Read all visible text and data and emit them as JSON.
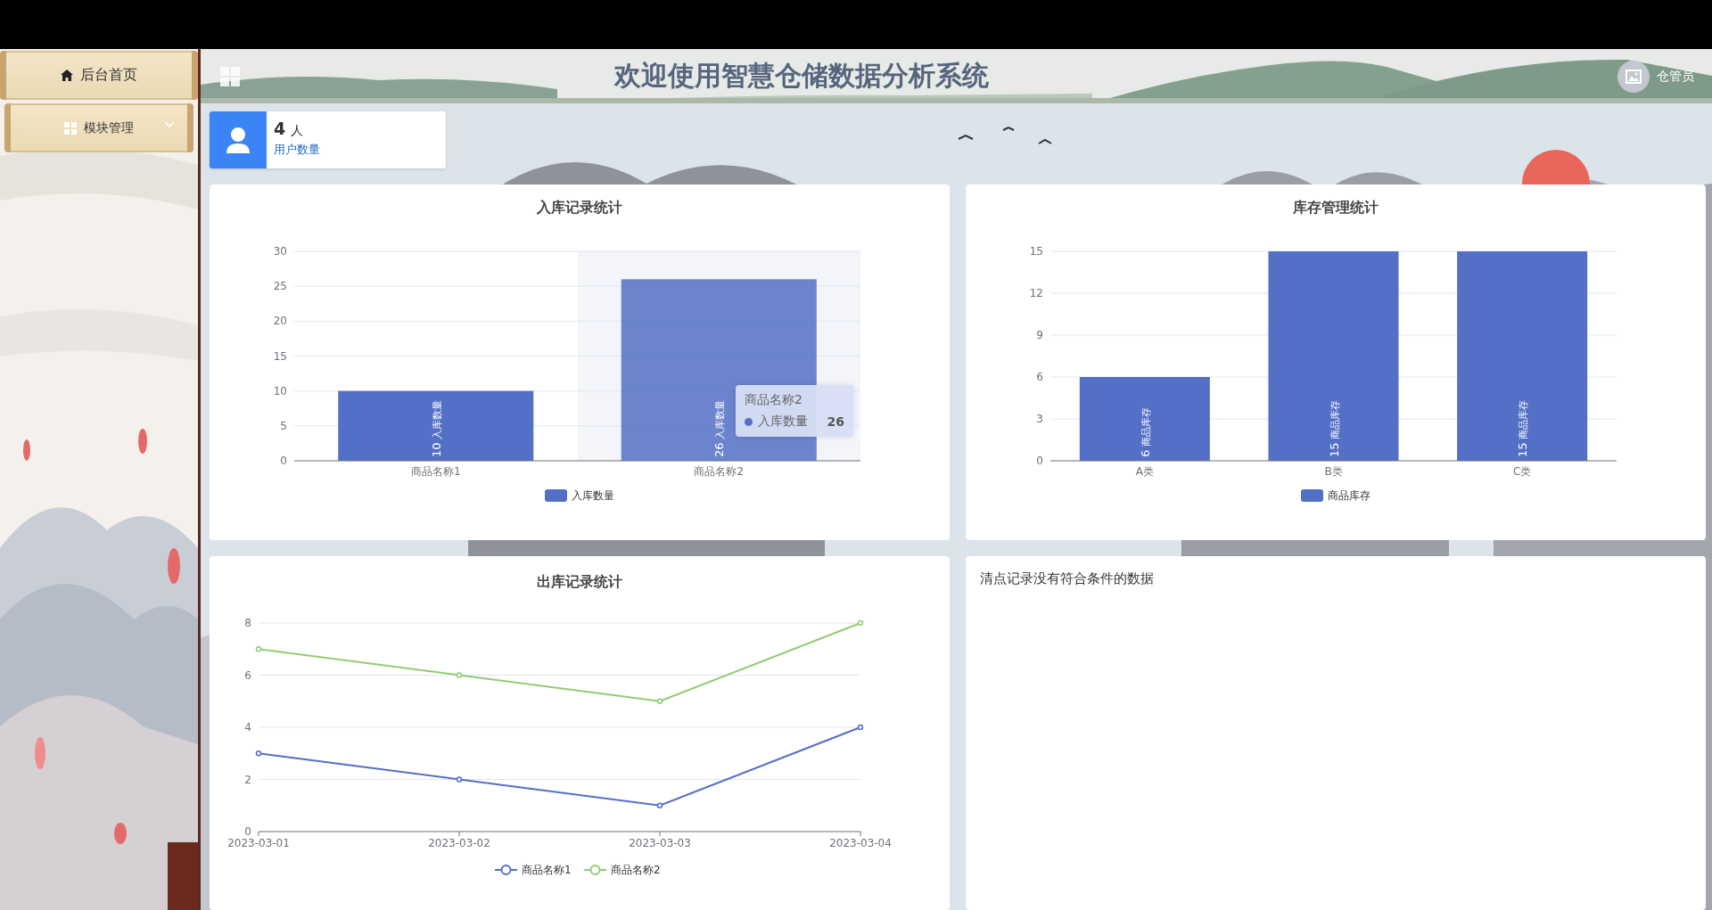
{
  "sidebar": {
    "items": [
      {
        "label": "后台首页",
        "kind": "link"
      },
      {
        "label": "模块管理",
        "kind": "submenu"
      }
    ]
  },
  "header": {
    "title": "欢迎使用智慧仓储数据分析系统",
    "user": "仓管员"
  },
  "stat_card": {
    "value": "4",
    "unit": "人",
    "label": "用户数量"
  },
  "charts": [
    {
      "hovered": [
        false,
        true
      ],
      "tooltip": {
        "title": "商品名称2",
        "series": "入库数量",
        "value": "26"
      },
      "chart_data": {
        "type": "bar",
        "title": "入库记录统计",
        "categories": [
          "商品名称1",
          "商品名称2"
        ],
        "series": [
          {
            "name": "入库数量",
            "color": "#5470c6",
            "values": [
              10,
              26
            ]
          }
        ],
        "ylim": [
          0,
          30
        ],
        "yticks": [
          0,
          5,
          10,
          15,
          20,
          25,
          30
        ],
        "data_labels": true,
        "grid": true,
        "legend": "bottom"
      }
    },
    {
      "chart_data": {
        "type": "bar",
        "title": "库存管理统计",
        "categories": [
          "A类",
          "B类",
          "C类"
        ],
        "series": [
          {
            "name": "商品库存",
            "color": "#5470c6",
            "values": [
              6,
              15,
              15
            ]
          }
        ],
        "ylim": [
          0,
          15
        ],
        "yticks": [
          0,
          3,
          6,
          9,
          12,
          15
        ],
        "data_labels": true,
        "grid": true,
        "legend": "bottom"
      }
    },
    {
      "chart_data": {
        "type": "line",
        "title": "出库记录统计",
        "x": [
          "2023-03-01",
          "2023-03-02",
          "2023-03-03",
          "2023-03-04"
        ],
        "series": [
          {
            "name": "商品名称1",
            "color": "#5470c6",
            "values": [
              3,
              2,
              1,
              4
            ],
            "marker": "circle"
          },
          {
            "name": "商品名称2",
            "color": "#91cc75",
            "values": [
              7,
              6,
              5,
              8
            ],
            "marker": "circle"
          }
        ],
        "ylim": [
          0,
          8
        ],
        "yticks": [
          0,
          2,
          4,
          6,
          8
        ],
        "grid": true,
        "legend": "bottom"
      }
    }
  ],
  "empty_panel": {
    "message": "清点记录没有符合条件的数据"
  }
}
